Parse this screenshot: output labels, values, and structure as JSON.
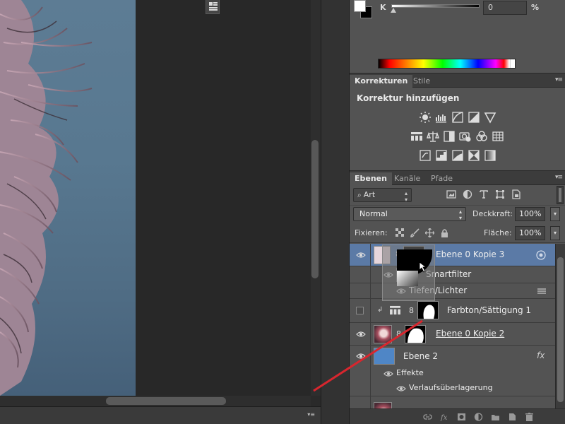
{
  "colors": {
    "panel_bg": "#535353",
    "tab_bg": "#3c3c3c",
    "selected_layer": "#5b7aa6",
    "canvas_blue": "#587890",
    "arrow_red": "#d8262e"
  },
  "color_panel": {
    "channel_label": "K",
    "channel_value": "0",
    "unit": "%",
    "k_level_percent": 0
  },
  "adjustments": {
    "tabs": [
      "Korrekturen",
      "Stile"
    ],
    "active_tab": "Korrekturen",
    "title": "Korrektur hinzufügen",
    "icon_rows": [
      [
        "brightness-icon",
        "levels-icon",
        "curves-icon",
        "exposure-icon",
        "vibrance-icon"
      ],
      [
        "hue-saturation-icon",
        "color-balance-icon",
        "black-white-icon",
        "photo-filter-icon",
        "channel-mixer-icon",
        "color-lookup-icon"
      ],
      [
        "invert-icon",
        "posterize-icon",
        "threshold-icon",
        "selective-color-icon",
        "gradient-map-icon"
      ]
    ]
  },
  "layers_panel": {
    "tabs": [
      "Ebenen",
      "Kanäle",
      "Pfade"
    ],
    "active_tab": "Ebenen",
    "filter_type": "Art",
    "blend_mode": "Normal",
    "opacity_label": "Deckkraft:",
    "opacity_value": "100%",
    "lock_label": "Fixieren:",
    "fill_label": "Fläche:",
    "fill_value": "100%",
    "layers": [
      {
        "name": "Ebene 0 Kopie 3",
        "visible": true,
        "selected": true
      },
      {
        "name": "Smartfilter",
        "visible": true,
        "kind": "smartfilter"
      },
      {
        "name": "Tiefen/Lichter",
        "visible": true,
        "kind": "filter"
      },
      {
        "name": "Farbton/Sättigung 1",
        "visible": false,
        "kind": "adjustment"
      },
      {
        "name": "Ebene 0 Kopie 2",
        "visible": true
      },
      {
        "name": "Ebene 2",
        "visible": true,
        "fx": "fx"
      },
      {
        "name": "Effekte",
        "visible": true,
        "kind": "effects"
      },
      {
        "name": "Verlaufsüberlagerung",
        "visible": true,
        "kind": "effect"
      }
    ]
  }
}
